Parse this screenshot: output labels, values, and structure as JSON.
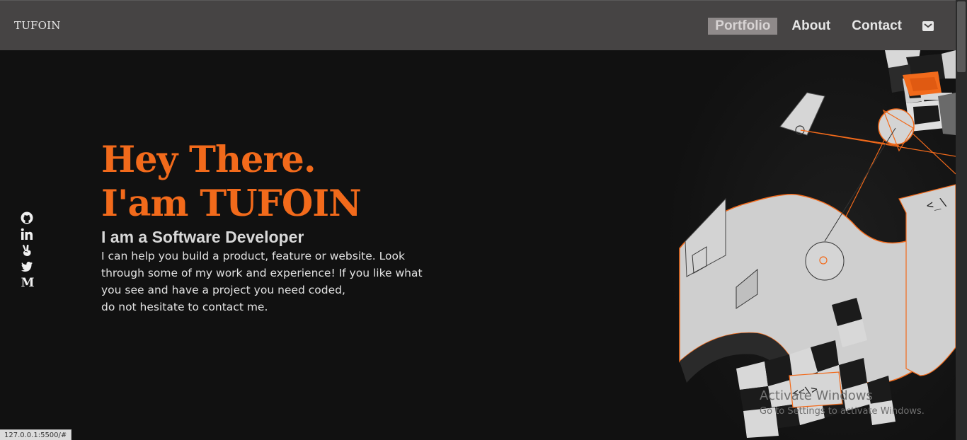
{
  "brand": "TUFOIN",
  "nav": {
    "items": [
      {
        "label": "Portfolio",
        "active": true
      },
      {
        "label": "About",
        "active": false
      },
      {
        "label": "Contact",
        "active": false
      }
    ],
    "mail_icon": "envelope-icon"
  },
  "social": {
    "icons": [
      "github-icon",
      "linkedin-icon",
      "peace-hand-icon",
      "twitter-icon",
      "medium-icon"
    ],
    "medium_glyph": "M"
  },
  "hero": {
    "greeting": "Hey There.",
    "name_line": "I'am TUFOIN",
    "role": "I am a Software Developer",
    "description_lines": [
      "I can help you build a product, feature or website. Look",
      "through some of my work and experience! If you like what",
      "you see and have a project you need coded,",
      "do not hesitate to contact me."
    ]
  },
  "illustration": {
    "code_tag_top": "<_\\",
    "code_tag_bottom": "<<\\>"
  },
  "watermark": {
    "title": "Activate Windows",
    "subtitle": "Go to Settings to activate Windows."
  },
  "status_url": "127.0.0.1:5500/#",
  "colors": {
    "accent": "#f26a1b",
    "nav_bg": "#464444",
    "page_bg": "#111111",
    "active_nav_bg": "#8f8a8a"
  }
}
